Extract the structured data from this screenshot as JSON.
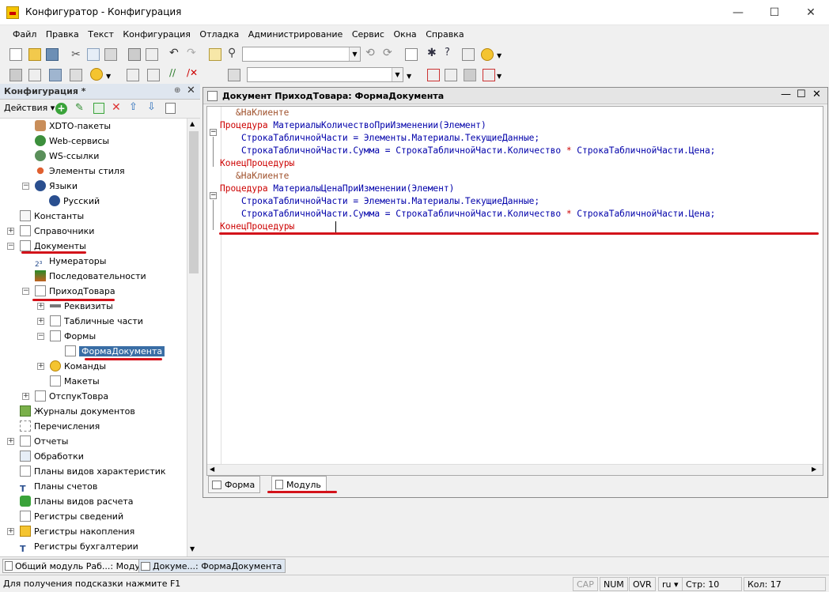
{
  "window": {
    "title": "Конфигуратор - Конфигурация",
    "minimize": "—",
    "maximize": "☐",
    "close": "✕"
  },
  "menu": [
    "Файл",
    "Правка",
    "Текст",
    "Конфигурация",
    "Отладка",
    "Администрирование",
    "Сервис",
    "Окна",
    "Справка"
  ],
  "left_panel": {
    "title": "Конфигурация *",
    "actions_label": "Действия ▾",
    "tree": [
      {
        "label": "XDTO-пакеты"
      },
      {
        "label": "Web-сервисы"
      },
      {
        "label": "WS-ссылки"
      },
      {
        "label": "Элементы стиля"
      },
      {
        "label": "Языки"
      },
      {
        "label": "Русский"
      },
      {
        "label": "Константы"
      },
      {
        "label": "Справочники"
      },
      {
        "label": "Документы"
      },
      {
        "label": "Нумераторы"
      },
      {
        "label": "Последовательности"
      },
      {
        "label": "ПриходТовара"
      },
      {
        "label": "Реквизиты"
      },
      {
        "label": "Табличные части"
      },
      {
        "label": "Формы"
      },
      {
        "label": "ФормаДокумента"
      },
      {
        "label": "Команды"
      },
      {
        "label": "Макеты"
      },
      {
        "label": "ОтспукТовра"
      },
      {
        "label": "Журналы документов"
      },
      {
        "label": "Перечисления"
      },
      {
        "label": "Отчеты"
      },
      {
        "label": "Обработки"
      },
      {
        "label": "Планы видов характеристик"
      },
      {
        "label": "Планы счетов"
      },
      {
        "label": "Планы видов расчета"
      },
      {
        "label": "Регистры сведений"
      },
      {
        "label": "Регистры накопления"
      },
      {
        "label": "Регистры бухгалтерии"
      }
    ]
  },
  "editor": {
    "title": "Документ ПриходТовара: ФормаДокумента",
    "code": {
      "l1": "&НаКлиенте",
      "l2_kw": "Процедура",
      "l2_rest": " МатериалыКоличествоПриИзменении(Элемент)",
      "l3": "    СтрокаТабличнойЧасти = Элементы.Материалы.ТекущиеДанные;",
      "l4_a": "    СтрокаТабличнойЧасти.Сумма = СтрокаТабличнойЧасти.Количество ",
      "l4_op": "*",
      "l4_b": " СтрокаТабличнойЧасти.Цена;",
      "l5": "КонецПроцедуры",
      "l6": "&НаКлиенте",
      "l7_kw": "Процедура",
      "l7_rest": " МатериалыЦенаПриИзменении(Элемент)",
      "l8": "    СтрокаТабличнойЧасти = Элементы.Материалы.ТекущиеДанные;",
      "l9_a": "    СтрокаТабличнойЧасти.Сумма = СтрокаТабличнойЧасти.Количество ",
      "l9_op": "*",
      "l9_b": " СтрокаТабличнойЧасти.Цена;",
      "l10": "КонецПроцедуры"
    },
    "tabs": [
      "Форма",
      "Модуль"
    ]
  },
  "taskbar": [
    "Общий модуль Раб...: Модуль",
    "Докуме...: ФормаДокумента"
  ],
  "status": {
    "hint": "Для получения подсказки нажмите F1",
    "cap": "CAP",
    "num": "NUM",
    "ovr": "OVR",
    "lang": "ru ▾",
    "line": "Стр: 10",
    "col": "Кол: 17"
  },
  "colors": {
    "accent": "#3a6ea5",
    "annotation": "#d3121a",
    "keyword": "#cc0000"
  }
}
